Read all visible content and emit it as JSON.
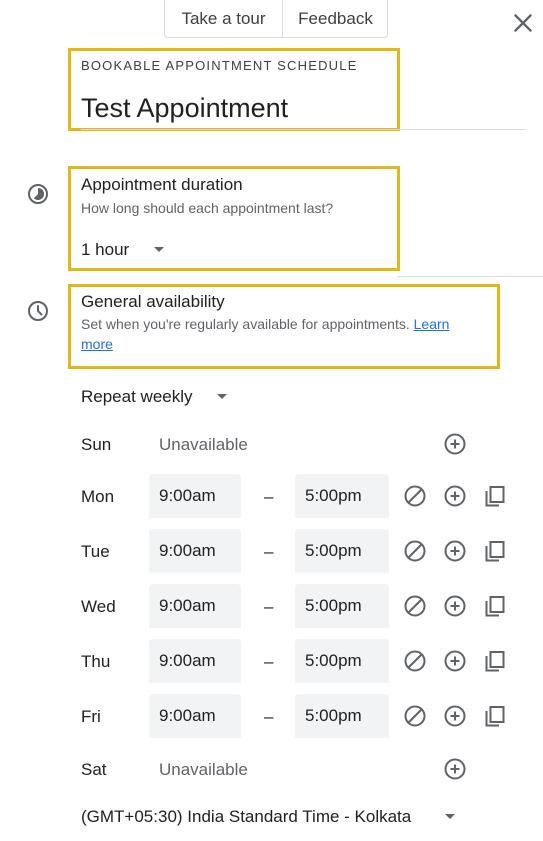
{
  "header": {
    "tour_label": "Take a tour",
    "feedback_label": "Feedback"
  },
  "schedule": {
    "eyebrow": "BOOKABLE APPOINTMENT SCHEDULE",
    "title": "Test Appointment"
  },
  "duration": {
    "title": "Appointment duration",
    "subtitle": "How long should each appointment last?",
    "value": "1 hour"
  },
  "availability": {
    "title": "General availability",
    "subtitle": "Set when you're regularly available for appointments.",
    "learn_more_1": "Learn",
    "learn_more_2": "more",
    "repeat": "Repeat weekly"
  },
  "days": [
    {
      "day": "Sun",
      "unavailable": "Unavailable"
    },
    {
      "day": "Mon",
      "start": "9:00am",
      "dash": "–",
      "end": "5:00pm"
    },
    {
      "day": "Tue",
      "start": "9:00am",
      "dash": "–",
      "end": "5:00pm"
    },
    {
      "day": "Wed",
      "start": "9:00am",
      "dash": "–",
      "end": "5:00pm"
    },
    {
      "day": "Thu",
      "start": "9:00am",
      "dash": "–",
      "end": "5:00pm"
    },
    {
      "day": "Fri",
      "start": "9:00am",
      "dash": "–",
      "end": "5:00pm"
    },
    {
      "day": "Sat",
      "unavailable": "Unavailable"
    }
  ],
  "timezone": "(GMT+05:30) India Standard Time - Kolkata",
  "colors": {
    "highlight": "#e2b716",
    "link": "#1a73e8",
    "field_bg": "#f1f3f4"
  }
}
